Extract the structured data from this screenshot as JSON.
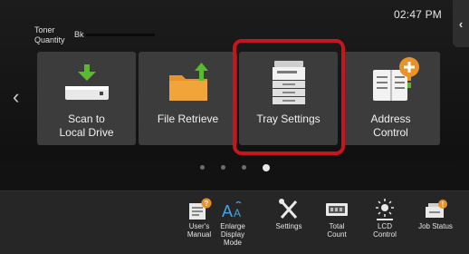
{
  "status_bar": {
    "time": "02:47 PM"
  },
  "home": {
    "tiles": [
      {
        "label_line1": "Scan to",
        "label_line2": "Local Drive",
        "icon": "usb-drive-download-icon"
      },
      {
        "label_line1": "File Retrieve",
        "label_line2": "",
        "icon": "folder-upload-icon"
      },
      {
        "label_line1": "Tray Settings",
        "label_line2": "",
        "icon": "printer-trays-icon",
        "highlighted": true
      },
      {
        "label_line1": "Address",
        "label_line2": "Control",
        "icon": "address-book-add-icon"
      }
    ],
    "page_indicator": {
      "pages": 4,
      "current": 4
    }
  },
  "toner": {
    "title_line1": "Toner",
    "title_line2": "Quantity",
    "color": "Bk",
    "level": 1.0
  },
  "bottom_buttons": [
    {
      "label_line1": "User's",
      "label_line2": "Manual",
      "label_line3": "",
      "icon": "manual-icon"
    },
    {
      "label_line1": "Enlarge",
      "label_line2": "Display",
      "label_line3": "Mode",
      "icon": "enlarge-text-icon"
    },
    {
      "label_line1": "Settings",
      "label_line2": "",
      "label_line3": "",
      "icon": "tools-icon"
    },
    {
      "label_line1": "Total",
      "label_line2": "Count",
      "label_line3": "",
      "icon": "counter-icon"
    },
    {
      "label_line1": "LCD",
      "label_line2": "Control",
      "label_line3": "",
      "icon": "brightness-icon"
    },
    {
      "label_line1": "Job Status",
      "label_line2": "",
      "label_line3": "",
      "icon": "job-status-icon"
    }
  ],
  "colors": {
    "highlight": "#c8151d",
    "icon_orange": "#e8922a",
    "icon_green": "#5cb82e"
  }
}
